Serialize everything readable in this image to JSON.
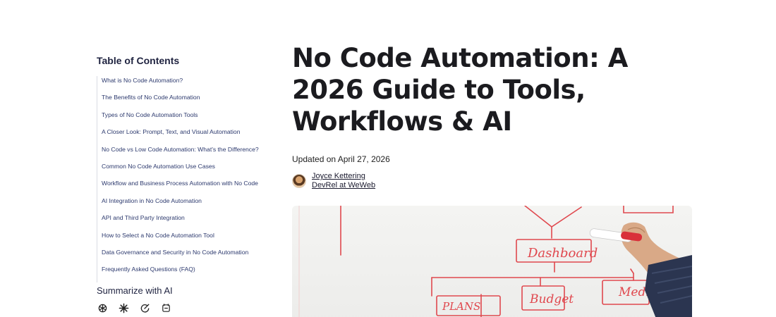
{
  "toc": {
    "title": "Table of Contents",
    "items": [
      "What is No Code Automation?",
      "The Benefits of No Code Automation",
      "Types of No Code Automation Tools",
      "A Closer Look: Prompt, Text, and Visual Automation",
      "No Code vs Low Code Automation: What's the Difference?",
      "Common No Code Automation Use Cases",
      "Workflow and Business Process Automation with No Code",
      "AI Integration in No Code Automation",
      "API and Third Party Integration",
      "How to Select a No Code Automation Tool",
      "Data Governance and Security in No Code Automation",
      "Frequently Asked Questions (FAQ)"
    ],
    "summarize_title": "Summarize with AI",
    "ai_icons": [
      "chatgpt-icon",
      "claude-icon",
      "perplexity-icon",
      "grok-icon"
    ]
  },
  "article": {
    "title": "No Code Automation: A 2026 Guide to Tools, Workflows & AI",
    "updated": "Updated on April 27, 2026",
    "author_name": "Joyce Kettering",
    "author_role": "DevRel at WeWeb"
  },
  "hero": {
    "words": [
      "Dashboard",
      "Budget",
      "Media",
      "PLANS"
    ],
    "ink_color": "#e0484e"
  }
}
